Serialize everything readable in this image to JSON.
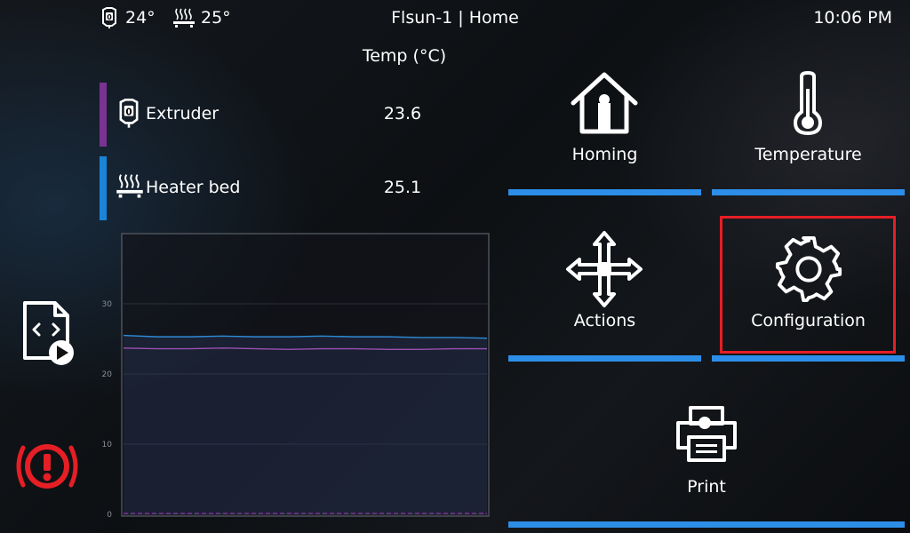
{
  "topbar": {
    "extruder_temp": "24°",
    "bed_temp": "25°",
    "title": "Flsun-1 | Home",
    "time": "10:06 PM"
  },
  "temperatures": {
    "header": "Temp (°C)",
    "rows": [
      {
        "label": "Extruder",
        "value": "23.6",
        "color": "#7b3393",
        "icon": "extruder-icon"
      },
      {
        "label": "Heater bed",
        "value": "25.1",
        "color": "#1a84d8",
        "icon": "heater-bed-icon"
      }
    ]
  },
  "graph": {
    "y_ticks": [
      "0",
      "10",
      "20",
      "30"
    ],
    "series": [
      {
        "color": "#2e8bd6",
        "values": [
          25.5,
          25.3,
          25.3,
          25.4,
          25.3,
          25.3,
          25.4,
          25.3,
          25.3,
          25.2,
          25.2,
          25.1
        ]
      },
      {
        "color": "#9a4fb0",
        "values": [
          23.7,
          23.6,
          23.6,
          23.7,
          23.6,
          23.5,
          23.6,
          23.6,
          23.5,
          23.5,
          23.6,
          23.6
        ]
      }
    ]
  },
  "menu": {
    "homing": "Homing",
    "temperature": "Temperature",
    "actions": "Actions",
    "configuration": "Configuration",
    "print": "Print"
  },
  "colors": {
    "accent": "#2d8ee8",
    "alert": "#e61e25"
  }
}
